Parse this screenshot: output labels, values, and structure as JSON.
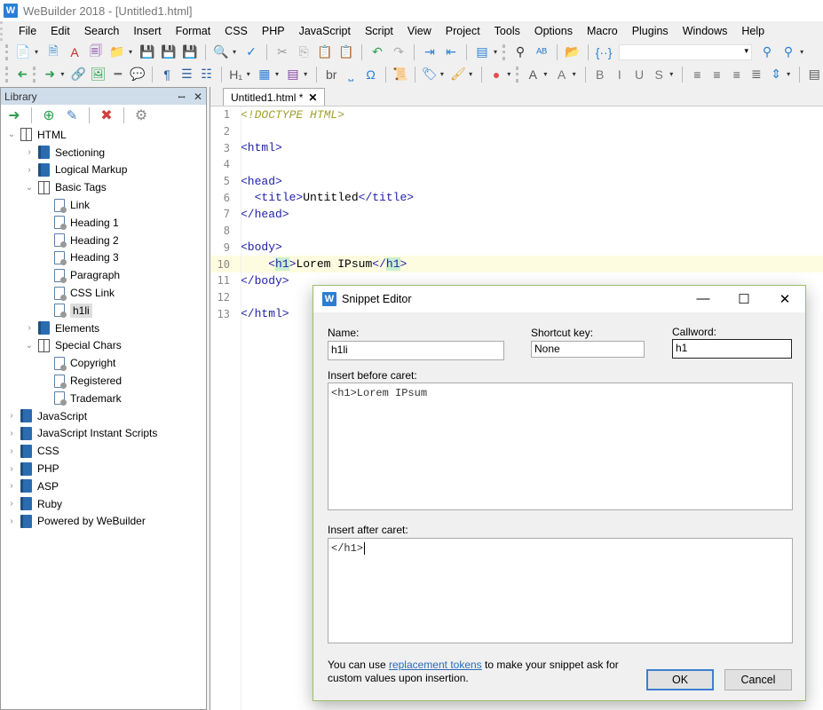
{
  "window": {
    "title": "WeBuilder 2018 - [Untitled1.html]",
    "logo": "W"
  },
  "menu": [
    "File",
    "Edit",
    "Search",
    "Insert",
    "Format",
    "CSS",
    "PHP",
    "JavaScript",
    "Script",
    "View",
    "Project",
    "Tools",
    "Options",
    "Macro",
    "Plugins",
    "Windows",
    "Help"
  ],
  "toolbar1": [
    {
      "icon": "new-file-icon",
      "glyph": "📄",
      "color": "#d8a020",
      "dd": true
    },
    {
      "icon": "new-html-icon",
      "glyph": "🗎",
      "color": "#3a8fd0"
    },
    {
      "icon": "new-pdf-icon",
      "glyph": "A",
      "color": "#c03030"
    },
    {
      "icon": "new-php-icon",
      "glyph": "🗐",
      "color": "#8040a0"
    },
    {
      "icon": "open-folder-icon",
      "glyph": "📁",
      "color": "#d8a020",
      "dd": true
    },
    {
      "icon": "save-icon",
      "glyph": "💾",
      "color": "#8040a0"
    },
    {
      "icon": "save-as-icon",
      "glyph": "💾",
      "color": "#8040a0"
    },
    {
      "icon": "save-upload-icon",
      "glyph": "💾",
      "color": "#3a9050",
      "sep": true
    },
    {
      "icon": "search-icon",
      "glyph": "🔍",
      "color": "#2a7fd4",
      "dd": true
    },
    {
      "icon": "spellcheck-icon",
      "glyph": "✓",
      "color": "#2a7fd4",
      "sep": true
    },
    {
      "icon": "cut-icon",
      "glyph": "✂",
      "color": "#999"
    },
    {
      "icon": "copy-icon",
      "glyph": "⎘",
      "color": "#aaa"
    },
    {
      "icon": "paste-icon",
      "glyph": "📋",
      "color": "#d8a020"
    },
    {
      "icon": "clipboard-icon",
      "glyph": "📋",
      "color": "#d8a020",
      "sep": true
    },
    {
      "icon": "undo-icon",
      "glyph": "↶",
      "color": "#30a050"
    },
    {
      "icon": "redo-icon",
      "glyph": "↷",
      "color": "#aaa",
      "sep": true
    },
    {
      "icon": "indent-icon",
      "glyph": "⇥",
      "color": "#2a7fd4"
    },
    {
      "icon": "outdent-icon",
      "glyph": "⇤",
      "color": "#2a7fd4",
      "sep": true
    },
    {
      "icon": "layout-icon",
      "glyph": "▤",
      "color": "#2a7fd4",
      "dd": true
    },
    {
      "icon": "find-icon",
      "glyph": "⚲",
      "color": "#333",
      "grip": true
    },
    {
      "icon": "replace-icon",
      "glyph": "ᴬᴮ",
      "color": "#2a7fd4",
      "sep": true
    },
    {
      "icon": "find-in-files-icon",
      "glyph": "📂",
      "color": "#d8a020",
      "sep": true
    },
    {
      "icon": "code-explorer-icon",
      "glyph": "{··}",
      "color": "#2a7fd4",
      "combo": true
    },
    {
      "icon": "find-prev-icon",
      "glyph": "⚲",
      "color": "#2a7fd4"
    },
    {
      "icon": "find-next-icon",
      "glyph": "⚲",
      "color": "#2a7fd4",
      "dd": true
    }
  ],
  "toolbar2": [
    {
      "icon": "back-arrow-icon",
      "glyph": "➜",
      "color": "#30a050",
      "flip": true
    },
    {
      "icon": "forward-arrow-icon",
      "glyph": "➜",
      "color": "#30a050",
      "dd": true,
      "grip": true
    },
    {
      "icon": "link-icon",
      "glyph": "🔗",
      "color": "#2a7fd4"
    },
    {
      "icon": "image-icon",
      "glyph": "🖼",
      "color": "#30a050"
    },
    {
      "icon": "horizontal-rule-icon",
      "glyph": "━",
      "color": "#777"
    },
    {
      "icon": "comment-icon",
      "glyph": "💬",
      "color": "#2a7fd4",
      "sep": true
    },
    {
      "icon": "paragraph-icon",
      "glyph": "¶",
      "color": "#2a5fa0"
    },
    {
      "icon": "unordered-list-icon",
      "glyph": "☰",
      "color": "#2a5fa0"
    },
    {
      "icon": "ordered-list-icon",
      "glyph": "☷",
      "color": "#2a5fa0",
      "sep": true
    },
    {
      "icon": "heading-icon",
      "glyph": "H₁",
      "color": "#555",
      "dd": true
    },
    {
      "icon": "table-icon",
      "glyph": "▦",
      "color": "#2a7fd4",
      "dd": true
    },
    {
      "icon": "form-icon",
      "glyph": "▤",
      "color": "#8040a0",
      "dd": true,
      "sep": true
    },
    {
      "icon": "line-break-icon",
      "glyph": "br",
      "color": "#555"
    },
    {
      "icon": "nbsp-icon",
      "glyph": "⎵",
      "color": "#2a7fd4"
    },
    {
      "icon": "omega-icon",
      "glyph": "Ω",
      "color": "#2a7fd4",
      "sep": true
    },
    {
      "icon": "script-icon",
      "glyph": "📜",
      "color": "#2a7fd4",
      "sep": true
    },
    {
      "icon": "tag-icon",
      "glyph": "🏷",
      "color": "#2a7fd4",
      "dd": true
    },
    {
      "icon": "brush-icon",
      "glyph": "🖌",
      "color": "#d8a020",
      "dd": true,
      "sep": true
    },
    {
      "icon": "color-icon",
      "glyph": "●",
      "color": "#e05050",
      "dd": true
    },
    {
      "icon": "font-size-increase-icon",
      "glyph": "A",
      "color": "#555",
      "dd": true,
      "grip": true
    },
    {
      "icon": "font-size-decrease-icon",
      "glyph": "A",
      "color": "#777",
      "dd": true,
      "sep": true
    },
    {
      "icon": "bold-icon",
      "glyph": "B",
      "color": "#777"
    },
    {
      "icon": "italic-icon",
      "glyph": "I",
      "color": "#777"
    },
    {
      "icon": "underline-icon",
      "glyph": "U",
      "color": "#777"
    },
    {
      "icon": "strikethrough-icon",
      "glyph": "S",
      "color": "#777",
      "dd": true,
      "sep": true
    },
    {
      "icon": "align-left-icon",
      "glyph": "≡",
      "color": "#555"
    },
    {
      "icon": "align-center-icon",
      "glyph": "≡",
      "color": "#555"
    },
    {
      "icon": "align-right-icon",
      "glyph": "≡",
      "color": "#555"
    },
    {
      "icon": "justify-icon",
      "glyph": "≣",
      "color": "#555"
    },
    {
      "icon": "line-spacing-icon",
      "glyph": "⇕",
      "color": "#2a7fd4",
      "dd": true,
      "sep": true
    },
    {
      "icon": "block-icon",
      "glyph": "▤",
      "color": "#555"
    }
  ],
  "library": {
    "title": "Library",
    "pin_glyph": "📌",
    "close_glyph": "✕",
    "tree": [
      {
        "level": 0,
        "label": "HTML",
        "type": "open",
        "expanded": true
      },
      {
        "level": 1,
        "label": "Sectioning",
        "type": "closed"
      },
      {
        "level": 1,
        "label": "Logical Markup",
        "type": "closed"
      },
      {
        "level": 1,
        "label": "Basic Tags",
        "type": "open",
        "expanded": true
      },
      {
        "level": 2,
        "label": "Link",
        "type": "snippet"
      },
      {
        "level": 2,
        "label": "Heading 1",
        "type": "snippet"
      },
      {
        "level": 2,
        "label": "Heading 2",
        "type": "snippet"
      },
      {
        "level": 2,
        "label": "Heading 3",
        "type": "snippet"
      },
      {
        "level": 2,
        "label": "Paragraph",
        "type": "snippet"
      },
      {
        "level": 2,
        "label": "CSS Link",
        "type": "snippet"
      },
      {
        "level": 2,
        "label": "h1li",
        "type": "snippet",
        "selected": true
      },
      {
        "level": 1,
        "label": "Elements",
        "type": "closed"
      },
      {
        "level": 1,
        "label": "Special Chars",
        "type": "open",
        "expanded": true
      },
      {
        "level": 2,
        "label": "Copyright",
        "type": "snippet"
      },
      {
        "level": 2,
        "label": "Registered",
        "type": "snippet"
      },
      {
        "level": 2,
        "label": "Trademark",
        "type": "snippet"
      },
      {
        "level": 0,
        "label": "JavaScript",
        "type": "closed"
      },
      {
        "level": 0,
        "label": "JavaScript Instant Scripts",
        "type": "closed"
      },
      {
        "level": 0,
        "label": "CSS",
        "type": "closed"
      },
      {
        "level": 0,
        "label": "PHP",
        "type": "closed"
      },
      {
        "level": 0,
        "label": "ASP",
        "type": "closed"
      },
      {
        "level": 0,
        "label": "Ruby",
        "type": "closed"
      },
      {
        "level": 0,
        "label": "Powered by WeBuilder",
        "type": "closed"
      }
    ]
  },
  "editor": {
    "tab_label": "Untitled1.html *",
    "tab_close": "✕",
    "highlighted_line": 10,
    "lines": [
      "<!DOCTYPE HTML>",
      "",
      "<html>",
      "",
      "<head>",
      "  <title>Untitled</title>",
      "</head>",
      "",
      "<body>",
      "    <h1>Lorem IPsum</h1>",
      "</body>",
      "",
      "</html>"
    ]
  },
  "dialog": {
    "title": "Snippet Editor",
    "minimize": "—",
    "maximize": "☐",
    "close": "✕",
    "name_label": "Name:",
    "name_value": "h1li",
    "shortcut_label": "Shortcut key:",
    "shortcut_value": "None",
    "callword_label": "Callword:",
    "callword_value": "h1",
    "before_label": "Insert before caret:",
    "before_value": "<h1>Lorem IPsum",
    "after_label": "Insert after caret:",
    "after_value": "</h1>",
    "help_prefix": "You can use ",
    "help_link": "replacement tokens",
    "help_suffix": " to make your snippet ask for custom values upon insertion.",
    "ok_label": "OK",
    "cancel_label": "Cancel"
  }
}
